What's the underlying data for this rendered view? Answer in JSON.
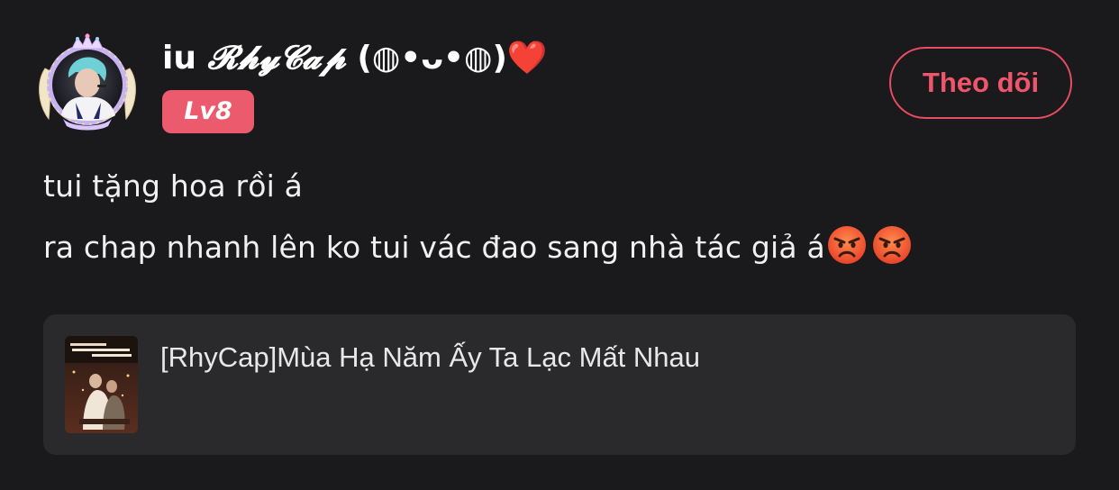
{
  "user": {
    "name_prefix": "iu ",
    "name_fancy": "𝓡𝓱𝔂𝓒𝓪𝓹",
    "name_suffix": " (◍•ᴗ•◍)",
    "heart": "❤️",
    "level": "Lv8",
    "avatar_icon": "avatar-with-crown-frame"
  },
  "follow_button": {
    "label": "Theo dõi"
  },
  "comment": {
    "line1": "tui tặng hoa rồi á",
    "line2": "ra chap nhanh lên ko tui vác đao sang nhà tác giả á",
    "emojis": [
      "angry-face-icon",
      "angry-face-icon"
    ]
  },
  "story": {
    "title": "[RhyCap]Mùa Hạ Năm Ấy Ta Lạc Mất Nhau"
  },
  "colors": {
    "background": "#1a191b",
    "accent": "#ec5a6d",
    "card": "#2a292b"
  }
}
